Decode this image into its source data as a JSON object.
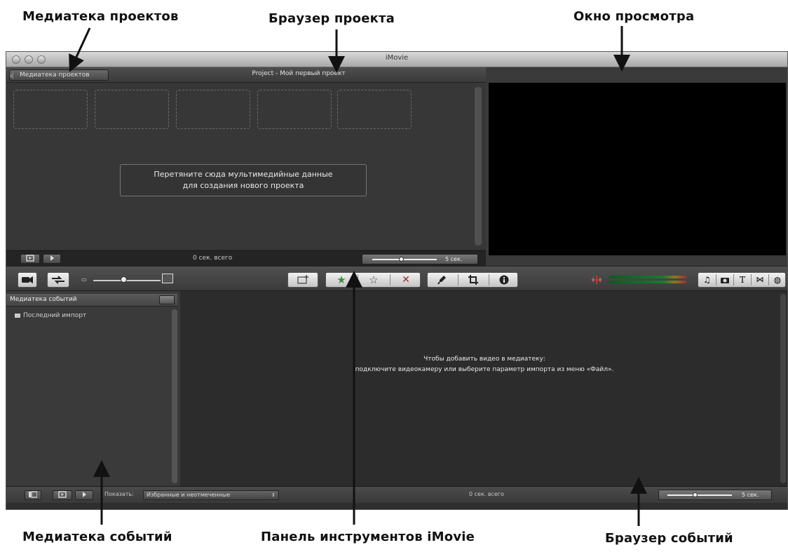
{
  "annotations": {
    "project_library": "Медиатека проектов",
    "project_browser": "Браузер проекта",
    "viewer": "Окно просмотра",
    "event_library": "Медиатека событий",
    "toolbar": "Панель инструментов  iMovie",
    "event_browser": "Браузер  событий"
  },
  "window": {
    "title": "iMovie"
  },
  "project": {
    "back_label": "Медиатека проектов",
    "title": "Project - Мой первый проект",
    "drop_line1": "Перетяните сюда мультимедийные данные",
    "drop_line2": "для создания нового проекта",
    "footer_status": "0 сек. всего",
    "zoom_label": "5 сек."
  },
  "events": {
    "library_title": "Медиатека событий",
    "last_import": "Последний импорт",
    "message_line1": "Чтобы добавить видео в медиатеку:",
    "message_line2": "подключите видеокамеру или выберите параметр импорта из меню «Файл».",
    "show_label": "Показать:",
    "show_value": "Избранные и неотмеченные",
    "footer_status": "0 сек. всего",
    "zoom_label": "5 сек."
  },
  "icons": {
    "camera": "camera-icon",
    "swap": "swap-icon",
    "favorite_star": "★",
    "unmark_star": "☆",
    "reject": "✕",
    "info": "ℹ",
    "crop": "crop-icon",
    "microphone": "microphone-icon"
  },
  "colors": {
    "window_bg": "#2e2e2e",
    "viewer_bg": "#000000",
    "favorite": "#3e8a3e",
    "reject": "#9a2a2a"
  }
}
